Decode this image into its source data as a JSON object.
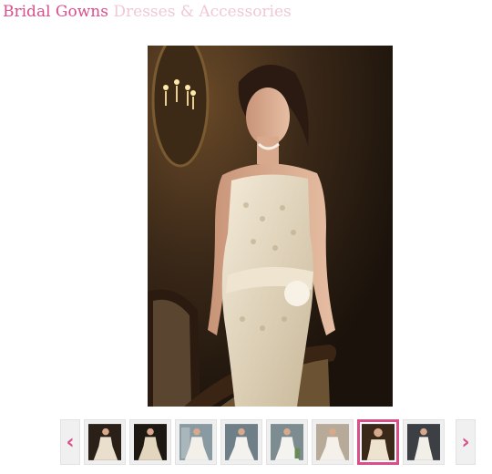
{
  "header": {
    "category": "Bridal Gowns",
    "subcategory": "Dresses & Accessories"
  },
  "gallery": {
    "prev_icon": "‹",
    "next_icon": "›",
    "active_index": 6,
    "thumbnail_count": 8
  },
  "colors": {
    "accent": "#d94f8a",
    "subtitle": "#f0c8d8"
  }
}
